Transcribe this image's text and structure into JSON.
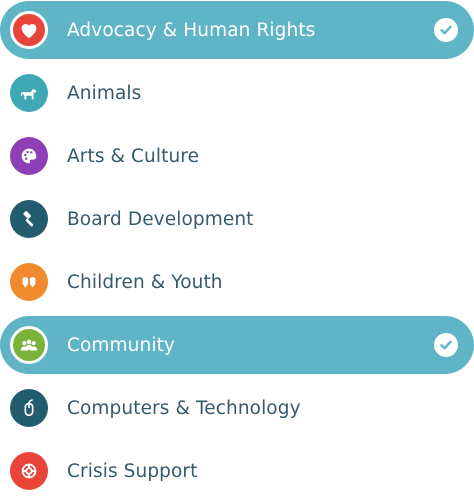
{
  "categories": [
    {
      "label": "Advocacy & Human Rights",
      "icon": "heart-icon",
      "color": "#e8443a",
      "selected": true
    },
    {
      "label": "Animals",
      "icon": "horse-icon",
      "color": "#3fa8b5",
      "selected": false
    },
    {
      "label": "Arts & Culture",
      "icon": "palette-icon",
      "color": "#8f3fb5",
      "selected": false
    },
    {
      "label": "Board Development",
      "icon": "gavel-icon",
      "color": "#235c6e",
      "selected": false
    },
    {
      "label": "Children & Youth",
      "icon": "kids-icon",
      "color": "#f08a2c",
      "selected": false
    },
    {
      "label": "Community",
      "icon": "people-icon",
      "color": "#7ab33a",
      "selected": true
    },
    {
      "label": "Computers & Technology",
      "icon": "mouse-icon",
      "color": "#235c6e",
      "selected": false
    },
    {
      "label": "Crisis Support",
      "icon": "lifebuoy-icon",
      "color": "#e8443a",
      "selected": false
    }
  ],
  "colors": {
    "selected_bg": "#5fb5c6",
    "text": "#355a6c"
  }
}
